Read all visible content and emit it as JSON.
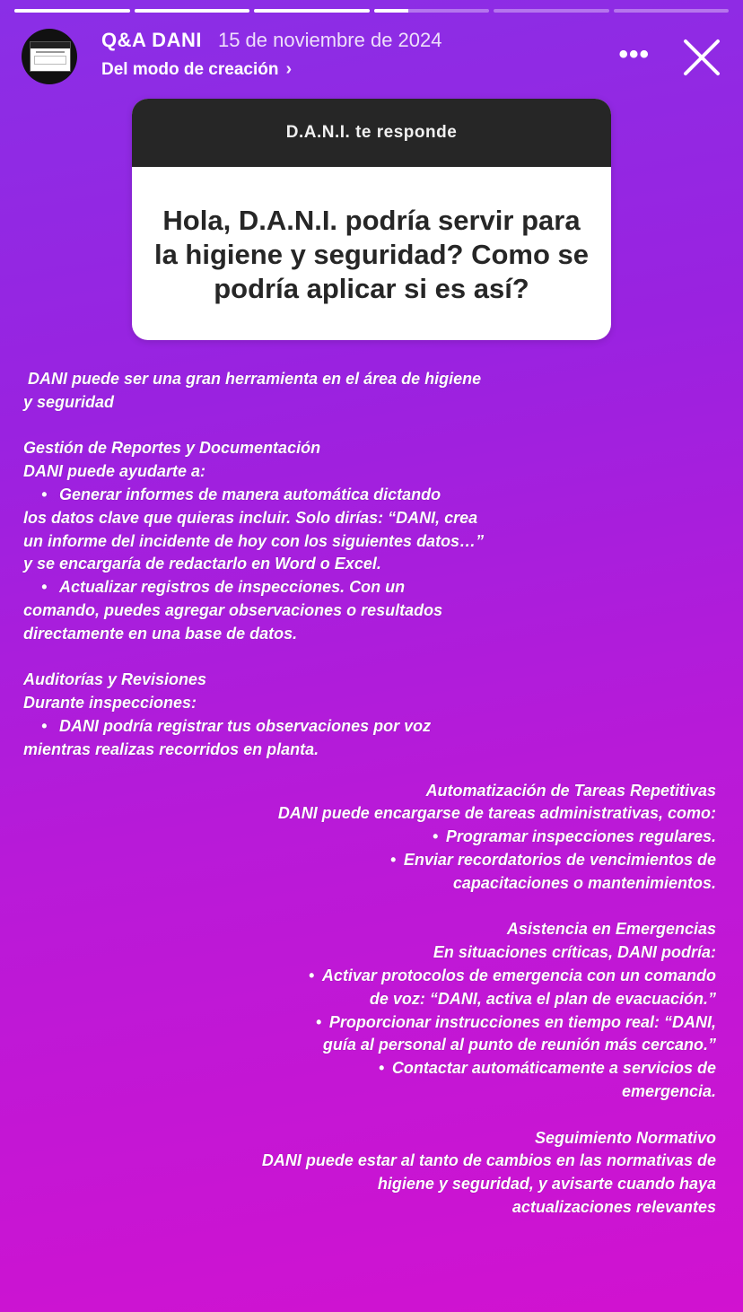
{
  "story": {
    "progress_segments": [
      1,
      1,
      1,
      0.3,
      0,
      0
    ],
    "account_name": "Q&A DANI",
    "date": "15 de noviembre de 2024",
    "source_label": "Del modo de creación",
    "more_label": "•••",
    "close_icon": "close-icon"
  },
  "question_box": {
    "header": "D.A.N.I. te responde",
    "question": "Hola, D.A.N.I. podría servir para la higiene y seguridad? Como se podría aplicar si es así?"
  },
  "answer": {
    "section1": " DANI puede ser una gran herramienta en el área de higiene\ny seguridad\n\nGestión de Reportes y Documentación\nDANI puede ayudarte a:\n\t•\tGenerar informes de manera automática dictando\nlos datos clave que quieras incluir. Solo dirías: “DANI, crea\nun informe del incidente de hoy con los siguientes datos…”\ny se encargaría de redactarlo en Word o Excel.\n\t•\tActualizar registros de inspecciones. Con un\ncomando, puedes agregar observaciones o resultados\ndirectamente en una base de datos.\n\nAuditorías y Revisiones\nDurante inspecciones:\n\t•\tDANI podría registrar tus observaciones por voz\nmientras realizas recorridos en planta.",
    "section2": "Automatización de Tareas Repetitivas\nDANI puede encargarse de tareas administrativas, como:\n•\tProgramar inspecciones regulares.\n•\tEnviar recordatorios de vencimientos de\ncapacitaciones o mantenimientos.\n\nAsistencia en Emergencias\nEn situaciones críticas, DANI podría:\n•\tActivar protocolos de emergencia con un comando\nde voz: “DANI, activa el plan de evacuación.”\n•\tProporcionar instrucciones en tiempo real: “DANI,\nguía al personal al punto de reunión más cercano.”\n•\tContactar automáticamente a servicios de\nemergencia.\n\nSeguimiento Normativo\nDANI puede estar al tanto de cambios en las normativas de\nhigiene y seguridad, y avisarte cuando haya\nactualizaciones relevantes"
  },
  "colors": {
    "gradient_top": "#8a2fe6",
    "gradient_bottom": "#d112d0",
    "question_header_bg": "#262626",
    "question_text": "#262626"
  }
}
